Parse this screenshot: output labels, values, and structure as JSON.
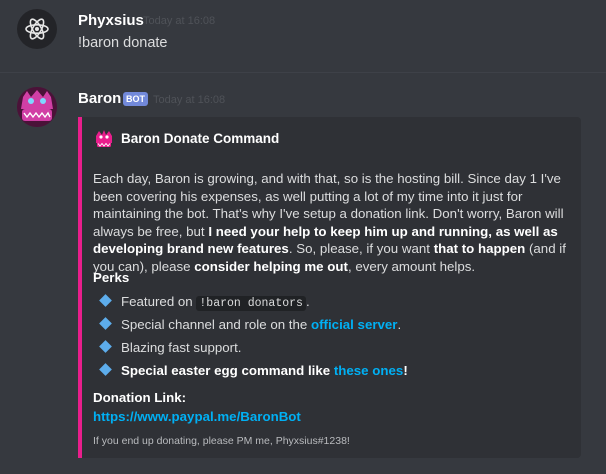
{
  "messages": [
    {
      "author": "Phyxsius",
      "timestamp": "Today at 16:08",
      "content": "!baron donate",
      "avatar_icon": "atom-icon"
    },
    {
      "author": "Baron",
      "bot_tag": "BOT",
      "timestamp": "Today at 16:08",
      "avatar_icon": "pink-monster-avatar"
    }
  ],
  "embed": {
    "accent_color": "#e91e8c",
    "author_icon": "pink-monster-icon",
    "title": "Baron Donate Command",
    "description_segments": {
      "s1": "Each day, Baron is growing, and with that, so is the hosting bill. Since day 1 I've been covering his expenses, as well putting a lot of my time into it just for maintaining the bot. That's why I've setup a donation link. Don't worry, Baron will always be free, but ",
      "b1": "I need your help to keep him up and running, as well as developing brand new features",
      "s2": ". So, please, if you want ",
      "b2": "that to happen",
      "s3": " (and if you can), please ",
      "b3": "consider helping me out",
      "s4": ", every amount helps."
    },
    "perks_title": "Perks",
    "perks": [
      {
        "text": "Featured on ",
        "code": "!baron donators",
        "after": "."
      },
      {
        "text": "Special channel and role on the ",
        "link": "official server",
        "after": "."
      },
      {
        "text": "Blazing fast support."
      },
      {
        "bold": "Special easter egg command like ",
        "link": "these ones",
        "after": "!"
      }
    ],
    "donation_title": "Donation Link:",
    "donation_link": "https://www.paypal.me/BaronBot",
    "footer": "If you end up donating, please PM me, Phyxsius#1238!"
  },
  "colors": {
    "background": "#36393f",
    "embed_background": "#2f3136",
    "link": "#00b0f4",
    "bullet": "#5dadec",
    "bot_tag": "#7289da"
  }
}
